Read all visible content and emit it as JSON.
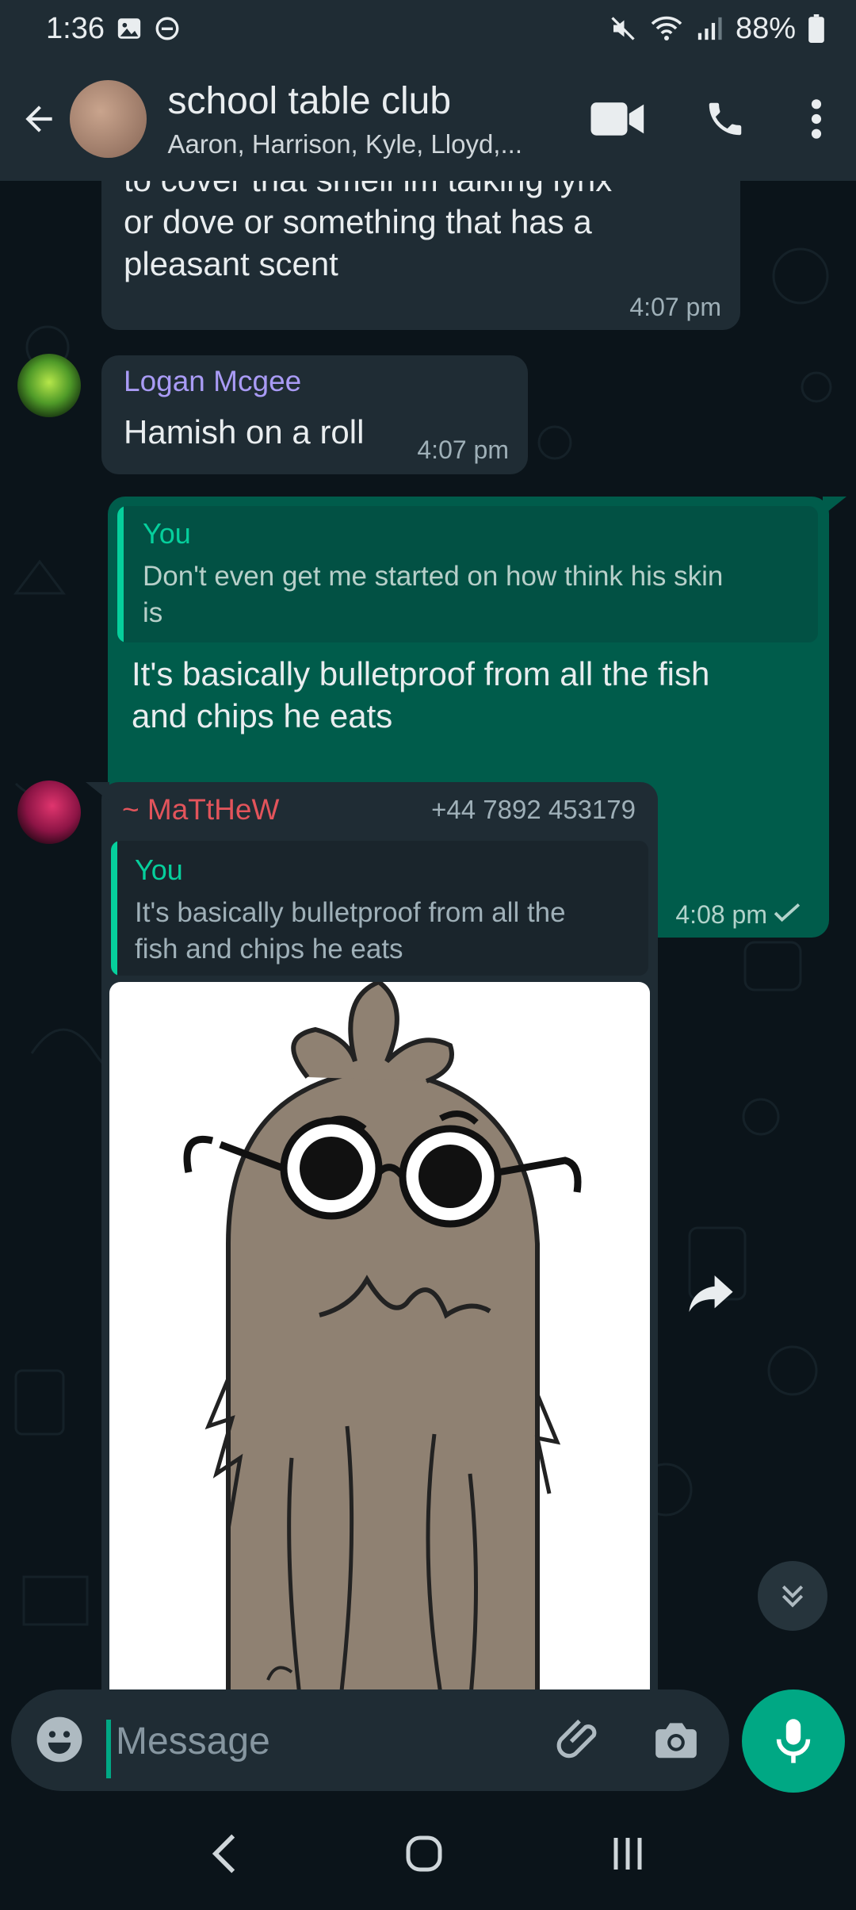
{
  "status_bar": {
    "time": "1:36",
    "battery": "88%"
  },
  "header": {
    "title": "school table club",
    "members": "Aaron, Harrison, Kyle, Lloyd,..."
  },
  "messages": {
    "m1": {
      "lines": [
        "to cover that smell im talking lynx",
        "or dove or something that has a",
        "pleasant scent"
      ],
      "time": "4:07 pm"
    },
    "m2": {
      "sender": "Logan Mcgee",
      "text": "Hamish on a roll",
      "time": "4:07 pm"
    },
    "m3": {
      "quote_author": "You",
      "quote_lines": [
        "Don't even get me started on how think his skin",
        "is"
      ],
      "lines": [
        "It's basically bulletproof from all the fish",
        "and chips he eats"
      ],
      "time": "4:08 pm"
    },
    "m4": {
      "sender": "~ MaTtHeW",
      "phone": "+44 7892 453179",
      "quote_author": "You",
      "quote_lines": [
        "It's basically bulletproof from all the",
        "fish and chips he eats"
      ]
    }
  },
  "composer": {
    "placeholder": "Message"
  },
  "colors": {
    "incoming_bubble": "#1f2c34",
    "outgoing_bubble": "#005c4b",
    "accent": "#00a884",
    "logan_name": "#a99bf5",
    "matthew_name": "#e2545b"
  }
}
